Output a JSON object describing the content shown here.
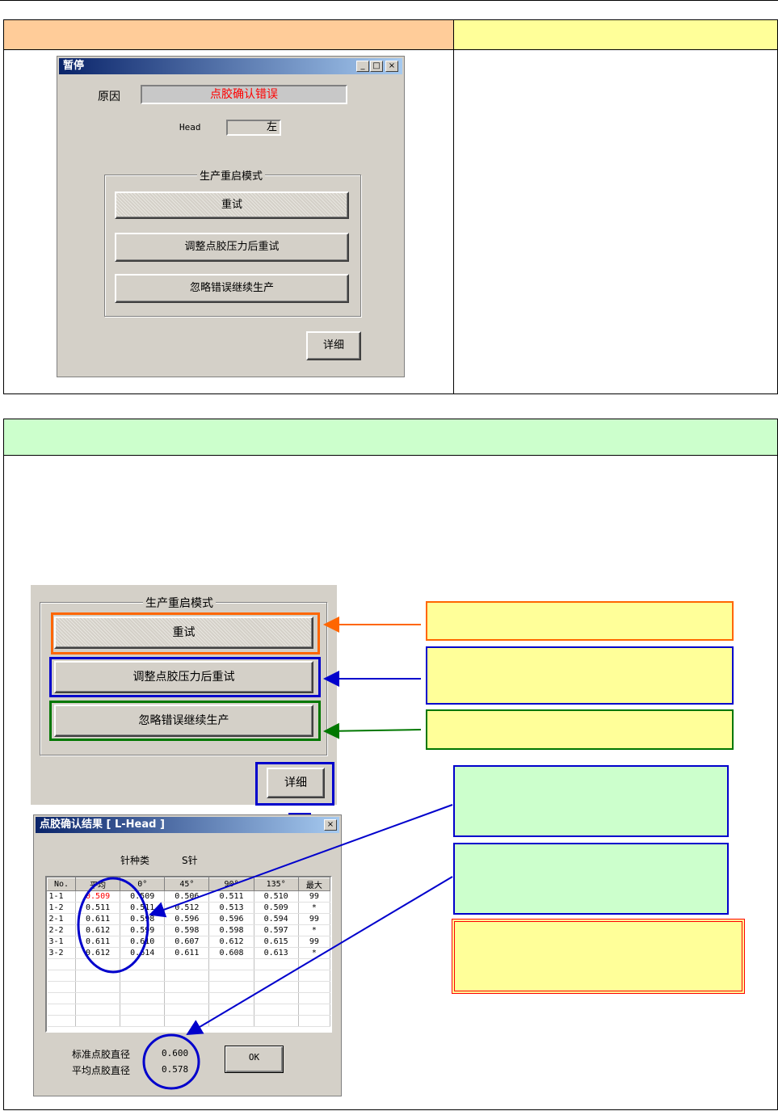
{
  "pause_dialog": {
    "title": "暂停",
    "cause_label": "原因",
    "cause_value": "点胶确认错误",
    "head_label": "Head",
    "head_value": "左",
    "group_label": "生产重启模式",
    "retry_label": "重试",
    "adjust_retry_label": "调整点胶压力后重试",
    "ignore_label": "忽略错误继续生产",
    "detail_label": "详细",
    "title_buttons": [
      "_",
      "□",
      "×"
    ]
  },
  "zoomed_panel": {
    "group_label": "生产重启模式",
    "retry_label": "重试",
    "adjust_retry_label": "调整点胶压力后重试",
    "ignore_label": "忽略错误继续生产",
    "detail_label": "详细"
  },
  "result_dialog": {
    "title": "点胶确认结果 [ L-Head ]",
    "needle_type_label": "针种类",
    "needle_type_value": "S针",
    "columns": [
      "No.",
      "平均",
      "0°",
      "45°",
      "90°",
      "135°",
      "最大"
    ],
    "rows": [
      [
        "1-1",
        "0.509",
        "0.509",
        "0.506",
        "0.511",
        "0.510",
        "99"
      ],
      [
        "1-2",
        "0.511",
        "0.511",
        "0.512",
        "0.513",
        "0.509",
        "*"
      ],
      [
        "2-1",
        "0.611",
        "0.598",
        "0.596",
        "0.596",
        "0.594",
        "99"
      ],
      [
        "2-2",
        "0.612",
        "0.599",
        "0.598",
        "0.598",
        "0.597",
        "*"
      ],
      [
        "3-1",
        "0.611",
        "0.610",
        "0.607",
        "0.612",
        "0.615",
        "99"
      ],
      [
        "3-2",
        "0.612",
        "0.614",
        "0.611",
        "0.608",
        "0.613",
        "*"
      ]
    ],
    "std_diameter_label": "标准点胶直径",
    "std_diameter_value": "0.600",
    "avg_diameter_label": "平均点胶直径",
    "avg_diameter_value": "0.578",
    "ok_label": "OK"
  },
  "colors": {
    "orange": "#ff6600",
    "blue": "#0000cc",
    "green": "#007700",
    "red": "#ff0000",
    "header_orange": "#ffcc99",
    "header_yellow": "#ffff99",
    "header_green": "#ccffcc"
  }
}
